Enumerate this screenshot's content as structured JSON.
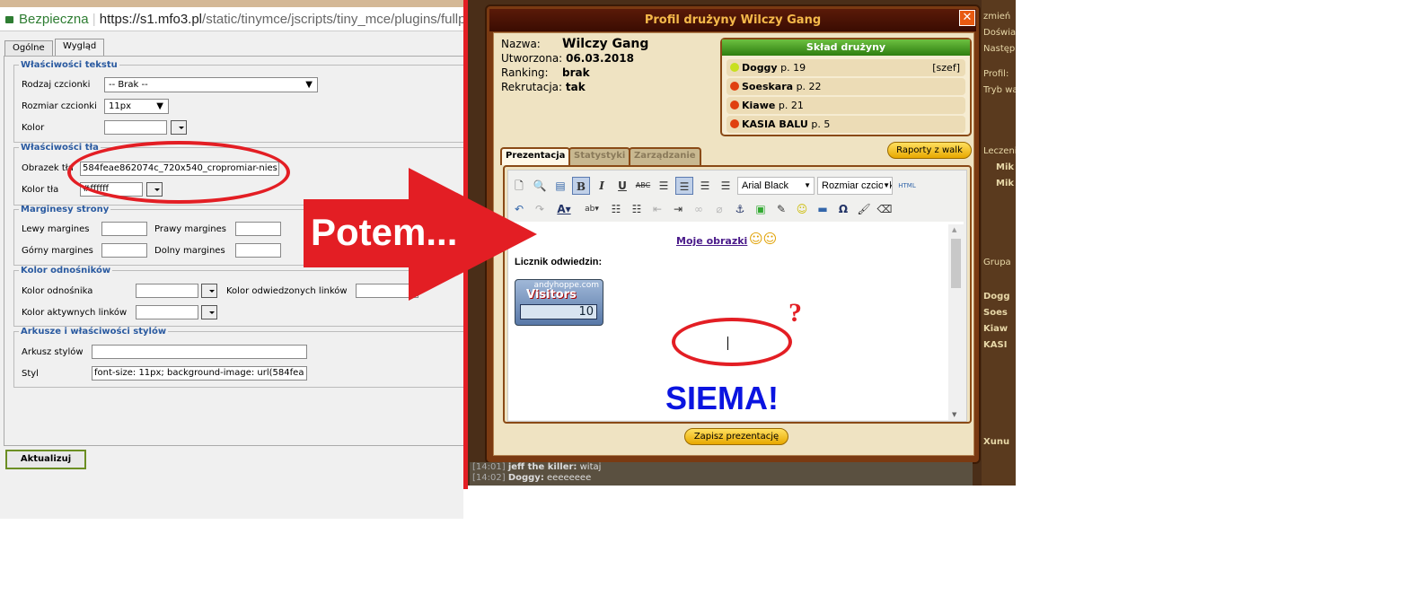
{
  "browser": {
    "secure_label": "Bezpieczna",
    "url_host": "https://s1.mfo3.pl",
    "url_path": "/static/tinymce/jscripts/tiny_mce/plugins/fullpage"
  },
  "left_dialog": {
    "tabs": [
      {
        "label": "Ogólne"
      },
      {
        "label": "Wygląd"
      }
    ],
    "text_props": {
      "legend": "Właściwości tekstu",
      "font_label": "Rodzaj czcionki",
      "font_value": "-- Brak --",
      "size_label": "Rozmiar czcionki",
      "size_value": "11px",
      "color_label": "Kolor"
    },
    "bg_props": {
      "legend": "Właściwości tła",
      "image_label": "Obrazek tła",
      "image_value": "584feae862074c_720x540_cropromiar-nies",
      "color_label": "Kolor tła",
      "color_value": "#ffffff"
    },
    "margins": {
      "legend": "Marginesy strony",
      "left": "Lewy margines",
      "right": "Prawy margines",
      "top": "Górny margines",
      "bottom": "Dolny margines"
    },
    "links": {
      "legend": "Kolor odnośników",
      "link": "Kolor odnośnika",
      "visited": "Kolor odwiedzonych linków",
      "active": "Kolor aktywnych linków"
    },
    "styles": {
      "legend": "Arkusze i właściwości stylów",
      "sheet_label": "Arkusz stylów",
      "style_label": "Styl",
      "style_value": "font-size: 11px; background-image: url(584fea"
    },
    "update_button": "Aktualizuj"
  },
  "annotation": {
    "arrow_text": "Potem...",
    "question": "?",
    "color": "#e31e24"
  },
  "game": {
    "title": "Profil drużyny Wilczy Gang",
    "close": "✕",
    "info": [
      {
        "k": "Nazwa:",
        "v": "Wilczy Gang"
      },
      {
        "k": "Utworzona:",
        "v": "06.03.2018"
      },
      {
        "k": "Ranking:",
        "v": "brak"
      },
      {
        "k": "Rekrutacja:",
        "v": "tak"
      }
    ],
    "roster": {
      "title": "Skład drużyny",
      "members": [
        {
          "name": "Doggy",
          "level": "p. 19",
          "role": "[szef]",
          "status": "#c8e020"
        },
        {
          "name": "Soeskara",
          "level": "p. 22",
          "role": "",
          "status": "#e04010"
        },
        {
          "name": "Kiawe",
          "level": "p. 21",
          "role": "",
          "status": "#e04010"
        },
        {
          "name": "KASIA BALU",
          "level": "p. 5",
          "role": "",
          "status": "#e04010"
        }
      ]
    },
    "tabs": [
      {
        "label": "Prezentacja"
      },
      {
        "label": "Statystyki"
      },
      {
        "label": "Zarządzanie"
      }
    ],
    "reports_button": "Raporty z walk",
    "toolbar": {
      "font": "Arial Black",
      "size": "Rozmiar czcionki",
      "html": "HTML",
      "row1": [
        "new-document",
        "preview",
        "template",
        "bold",
        "italic",
        "underline",
        "strikethrough",
        "align-left",
        "align-center",
        "align-right",
        "justify"
      ],
      "row2": [
        "undo",
        "redo",
        "font-color",
        "highlight",
        "bullet-list",
        "number-list",
        "outdent",
        "indent",
        "link",
        "unlink",
        "anchor",
        "image",
        "edit",
        "emoticon",
        "horizontal-rule",
        "special-char",
        "cleanup",
        "eraser"
      ]
    },
    "content": {
      "link": "Moje obrazki",
      "counter_label": "Licznik odwiedzin:",
      "counter_site": "andyhoppe.com",
      "counter_brand": "Visitors",
      "counter_value": "10",
      "heading": "SIEMA!"
    },
    "save_button": "Zapisz prezentację",
    "chat": [
      {
        "time": "[14:01]",
        "user": "jeff the killer:",
        "msg": "witaj"
      },
      {
        "time": "[14:02]",
        "user": "Doggy:",
        "msg": "eeeeeeee"
      }
    ],
    "side": [
      "zmień",
      "Doświad",
      "Następn",
      "Profil:",
      "Tryb wa",
      "Leczeni",
      "Mik",
      "Mik",
      "Grupa",
      "Dogg",
      "Soes",
      "Kiaw",
      "KASI",
      "Xunu"
    ]
  }
}
